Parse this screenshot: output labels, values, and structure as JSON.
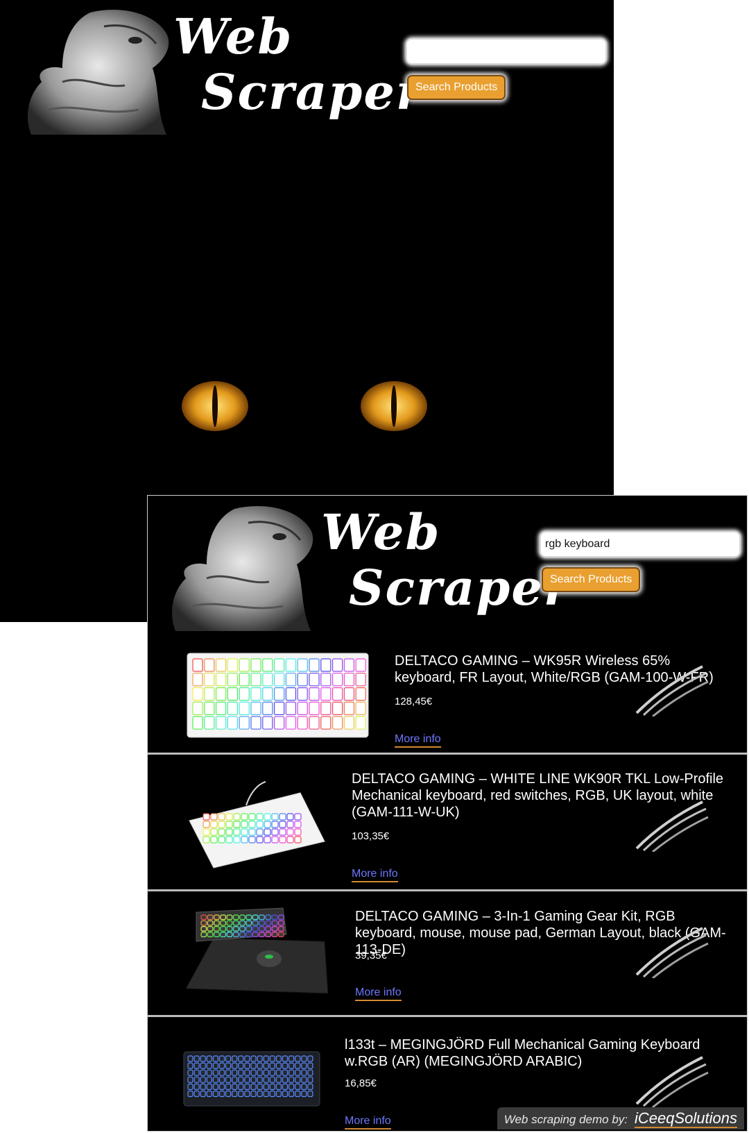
{
  "logo": {
    "line1": "Web",
    "line2": "Scraper"
  },
  "window1": {
    "search": {
      "value": "",
      "button_label": "Search Products"
    }
  },
  "window2": {
    "search": {
      "value": "rgb keyboard",
      "button_label": "Search Products"
    },
    "results": [
      {
        "title": "DELTACO GAMING – WK95R Wireless 65% keyboard, FR Layout, White/RGB (GAM-100-W-FR)",
        "price": "128,45€",
        "link": "More info",
        "image": "white-65-keyboard"
      },
      {
        "title": "DELTACO GAMING – WHITE LINE WK90R TKL Low-Profile Mechanical keyboard, red switches, RGB, UK layout, white (GAM-111-W-UK)",
        "price": "103,35€",
        "link": "More info",
        "image": "white-tkl-keyboard"
      },
      {
        "title": "DELTACO GAMING – 3-In-1 Gaming Gear Kit, RGB keyboard, mouse, mouse pad, German Layout, black (GAM-113-DE)",
        "price": "39,35€",
        "link": "More info",
        "image": "gaming-kit"
      },
      {
        "title": "l133t – MEGINGJÖRD Full Mechanical Gaming Keyboard w.RGB (AR) (MEGINGJÖRD ARABIC)",
        "price": "16,85€",
        "link": "More info",
        "image": "black-full-keyboard"
      }
    ],
    "credit": {
      "prefix": "Web scraping demo by:",
      "brand": "iCeeqSolutions"
    }
  },
  "colors": {
    "accent": "#d38a32",
    "button": "#e9a030",
    "link": "#6d78ff",
    "background": "#000000"
  }
}
